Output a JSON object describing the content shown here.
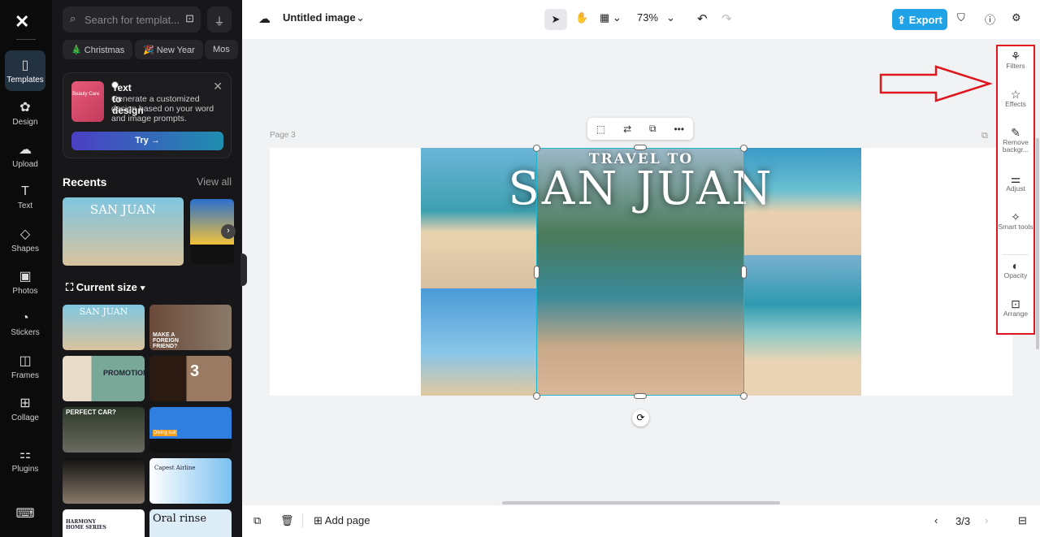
{
  "rail": {
    "items": [
      {
        "label": "Templates",
        "icon": "templates-icon",
        "glyph": "▯"
      },
      {
        "label": "Design",
        "icon": "design-icon",
        "glyph": "✿"
      },
      {
        "label": "Upload",
        "icon": "upload-icon",
        "glyph": "☁"
      },
      {
        "label": "Text",
        "icon": "text-icon",
        "glyph": "T"
      },
      {
        "label": "Shapes",
        "icon": "shapes-icon",
        "glyph": "◇"
      },
      {
        "label": "Photos",
        "icon": "photos-icon",
        "glyph": "▣"
      },
      {
        "label": "Stickers",
        "icon": "stickers-icon",
        "glyph": "◔"
      },
      {
        "label": "Frames",
        "icon": "frames-icon",
        "glyph": "◫"
      },
      {
        "label": "Collage",
        "icon": "collage-icon",
        "glyph": "⊞"
      },
      {
        "label": "Plugins",
        "icon": "plugins-icon",
        "glyph": "⚏"
      }
    ]
  },
  "panel": {
    "search_placeholder": "Search for templat...",
    "chips": [
      "🎄 Christmas",
      "🎉 New Year",
      "Mos"
    ],
    "text_to_design": {
      "title": "Text to design",
      "desc": "Generate a customized design based on your word and image prompts.",
      "thumb_text": "Beauty Care",
      "try": "Try →"
    },
    "recents": "Recents",
    "view_all": "View all",
    "current_size": "Current size",
    "templates": [
      "SAN JUAN",
      "MAKE A FOREIGN FRIEND?",
      "PROMOTION",
      "3",
      "PERFECT CAR?",
      "Diving suit",
      "",
      "Capest Airline",
      "HARMONY HOME SERIES",
      "Oral rinse"
    ]
  },
  "topbar": {
    "doc_title": "Untitled image",
    "zoom": "73%",
    "export": "Export"
  },
  "canvas": {
    "page_label": "Page 3",
    "title_small": "TRAVEL TO",
    "title_big": "SAN JUAN"
  },
  "right_panel": [
    {
      "label": "Filters",
      "glyph": "⚘"
    },
    {
      "label": "Effects",
      "glyph": "☆"
    },
    {
      "label": "Remove backgr...",
      "glyph": "✎"
    },
    {
      "label": "Adjust",
      "glyph": "⚌"
    },
    {
      "label": "Smart tools",
      "glyph": "✧"
    },
    {
      "label": "Opacity",
      "glyph": "◐"
    },
    {
      "label": "Arrange",
      "glyph": "⊡"
    }
  ],
  "bottombar": {
    "add_page": "Add page",
    "page_indicator": "3/3"
  },
  "colors": {
    "accent": "#1fa3e6",
    "highlight": "#e0161e"
  }
}
